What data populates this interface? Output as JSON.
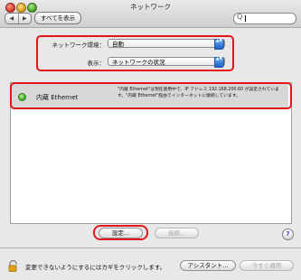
{
  "window": {
    "title": "ネットワーク"
  },
  "toolbar": {
    "back_glyph": "◀",
    "forward_glyph": "▶",
    "show_all_label": "すべてを表示",
    "search_icon": "search-icon",
    "search_glyph": "Q",
    "search_value": ""
  },
  "settings": {
    "location_label": "ネットワーク環境：",
    "location_value": "自動",
    "show_label": "表示：",
    "show_value": "ネットワークの状況",
    "popup_arrows": "▲▼"
  },
  "connections": [
    {
      "status_color": "#38a81f",
      "name": "内蔵 Ethernet",
      "description": "\"内蔵 Ethernet\"は現在使用中で、IP アドレス 192.168.200.60 が設定されています。\"内蔵 Ethernet\"経由でインターネットに接続しています。"
    }
  ],
  "buttons": {
    "configure_label": "設定...",
    "connect_label": "接続...",
    "help_glyph": "?",
    "assistant_label": "アシスタント...",
    "apply_label": "今すぐ適用"
  },
  "footer": {
    "lock_message": "変更できないようにするにはカギをクリックします。"
  },
  "colors": {
    "highlight_outline": "#e0181a",
    "popup_arrow_blue": "#1e62c9"
  }
}
